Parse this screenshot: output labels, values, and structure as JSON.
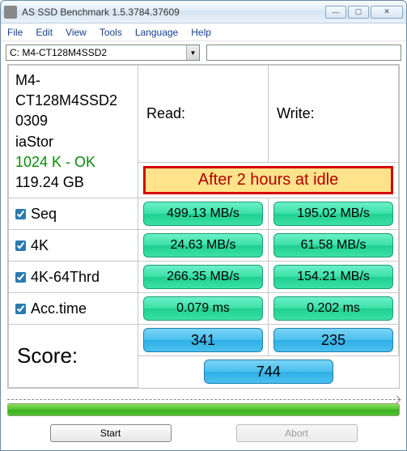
{
  "window": {
    "title": "AS SSD Benchmark 1.5.3784.37609"
  },
  "menu": {
    "file": "File",
    "edit": "Edit",
    "view": "View",
    "tools": "Tools",
    "language": "Language",
    "help": "Help"
  },
  "combo": {
    "selected": "C: M4-CT128M4SSD2"
  },
  "info": {
    "model": "M4-CT128M4SSD2",
    "fw": "0309",
    "driver": "iaStor",
    "align": "1024 K - OK",
    "size": "119.24 GB"
  },
  "headers": {
    "read": "Read:",
    "write": "Write:"
  },
  "banner": "After 2 hours at idle",
  "rows": {
    "seq": {
      "label": "Seq",
      "read": "499.13 MB/s",
      "write": "195.02 MB/s"
    },
    "k4": {
      "label": "4K",
      "read": "24.63 MB/s",
      "write": "61.58 MB/s"
    },
    "k464": {
      "label": "4K-64Thrd",
      "read": "266.35 MB/s",
      "write": "154.21 MB/s"
    },
    "acc": {
      "label": "Acc.time",
      "read": "0.079 ms",
      "write": "0.202 ms"
    }
  },
  "score": {
    "label": "Score:",
    "read": "341",
    "write": "235",
    "total": "744"
  },
  "buttons": {
    "start": "Start",
    "abort": "Abort"
  }
}
